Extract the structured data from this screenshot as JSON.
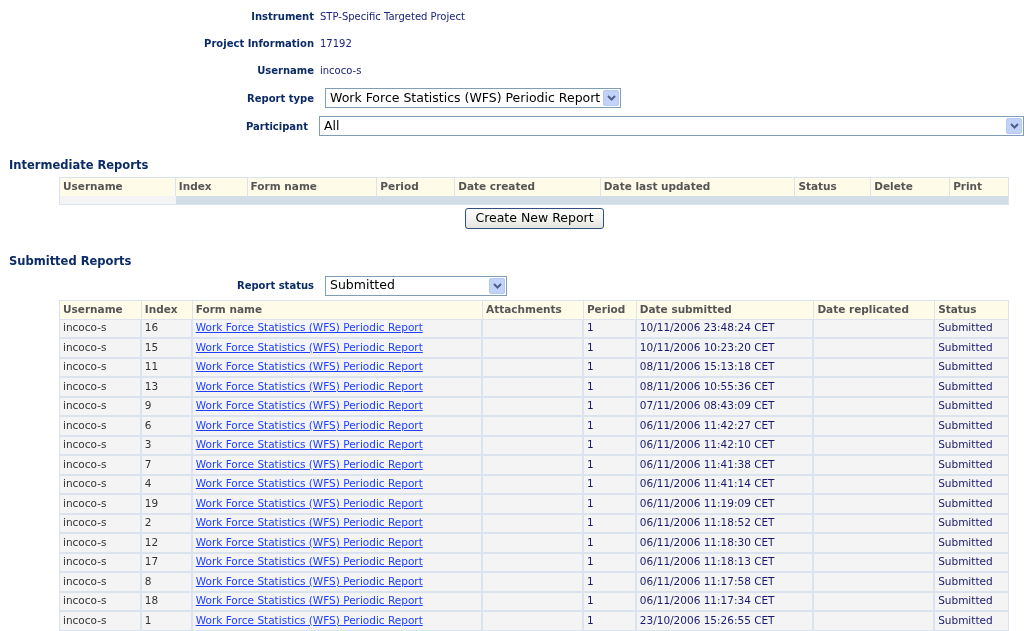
{
  "info": [
    {
      "label": "Instrument",
      "value": "STP-Specific Targeted Project"
    },
    {
      "label": "Project Information",
      "value": "17192"
    },
    {
      "label": "Username",
      "value": "incoco-s"
    }
  ],
  "filters": [
    {
      "label": "Report type",
      "value": "Work Force Statistics (WFS) Periodic Report",
      "kind": "short"
    },
    {
      "label": "Participant",
      "value": "All",
      "kind": "wide"
    }
  ],
  "intermediate": {
    "title": "Intermediate Reports",
    "columns": [
      "Username",
      "Index",
      "Form name",
      "Period",
      "Date created",
      "Date last updated",
      "Status",
      "Delete",
      "Print"
    ],
    "create_button": "Create New Report"
  },
  "submitted": {
    "title": "Submitted Reports",
    "status_filter": {
      "label": "Report status",
      "value": "Submitted"
    },
    "columns": [
      "Username",
      "Index",
      "Form name",
      "Attachments",
      "Period",
      "Date submitted",
      "Date replicated",
      "Status"
    ],
    "rows": [
      {
        "username": "incoco-s",
        "index": "16",
        "form_name": "Work Force Statistics (WFS) Periodic Report",
        "period": "1",
        "date_submitted": "10/11/2006 23:48:24 CET",
        "status": "Submitted"
      },
      {
        "username": "incoco-s",
        "index": "15",
        "form_name": "Work Force Statistics (WFS) Periodic Report",
        "period": "1",
        "date_submitted": "10/11/2006 10:23:20 CET",
        "status": "Submitted"
      },
      {
        "username": "incoco-s",
        "index": "11",
        "form_name": "Work Force Statistics (WFS) Periodic Report",
        "period": "1",
        "date_submitted": "08/11/2006 15:13:18 CET",
        "status": "Submitted"
      },
      {
        "username": "incoco-s",
        "index": "13",
        "form_name": "Work Force Statistics (WFS) Periodic Report",
        "period": "1",
        "date_submitted": "08/11/2006 10:55:36 CET",
        "status": "Submitted"
      },
      {
        "username": "incoco-s",
        "index": "9",
        "form_name": "Work Force Statistics (WFS) Periodic Report",
        "period": "1",
        "date_submitted": "07/11/2006 08:43:09 CET",
        "status": "Submitted"
      },
      {
        "username": "incoco-s",
        "index": "6",
        "form_name": "Work Force Statistics (WFS) Periodic Report",
        "period": "1",
        "date_submitted": "06/11/2006 11:42:27 CET",
        "status": "Submitted"
      },
      {
        "username": "incoco-s",
        "index": "3",
        "form_name": "Work Force Statistics (WFS) Periodic Report",
        "period": "1",
        "date_submitted": "06/11/2006 11:42:10 CET",
        "status": "Submitted"
      },
      {
        "username": "incoco-s",
        "index": "7",
        "form_name": "Work Force Statistics (WFS) Periodic Report",
        "period": "1",
        "date_submitted": "06/11/2006 11:41:38 CET",
        "status": "Submitted"
      },
      {
        "username": "incoco-s",
        "index": "4",
        "form_name": "Work Force Statistics (WFS) Periodic Report",
        "period": "1",
        "date_submitted": "06/11/2006 11:41:14 CET",
        "status": "Submitted"
      },
      {
        "username": "incoco-s",
        "index": "19",
        "form_name": "Work Force Statistics (WFS) Periodic Report",
        "period": "1",
        "date_submitted": "06/11/2006 11:19:09 CET",
        "status": "Submitted"
      },
      {
        "username": "incoco-s",
        "index": "2",
        "form_name": "Work Force Statistics (WFS) Periodic Report",
        "period": "1",
        "date_submitted": "06/11/2006 11:18:52 CET",
        "status": "Submitted"
      },
      {
        "username": "incoco-s",
        "index": "12",
        "form_name": "Work Force Statistics (WFS) Periodic Report",
        "period": "1",
        "date_submitted": "06/11/2006 11:18:30 CET",
        "status": "Submitted"
      },
      {
        "username": "incoco-s",
        "index": "17",
        "form_name": "Work Force Statistics (WFS) Periodic Report",
        "period": "1",
        "date_submitted": "06/11/2006 11:18:13 CET",
        "status": "Submitted"
      },
      {
        "username": "incoco-s",
        "index": "8",
        "form_name": "Work Force Statistics (WFS) Periodic Report",
        "period": "1",
        "date_submitted": "06/11/2006 11:17:58 CET",
        "status": "Submitted"
      },
      {
        "username": "incoco-s",
        "index": "18",
        "form_name": "Work Force Statistics (WFS) Periodic Report",
        "period": "1",
        "date_submitted": "06/11/2006 11:17:34 CET",
        "status": "Submitted"
      },
      {
        "username": "incoco-s",
        "index": "1",
        "form_name": "Work Force Statistics (WFS) Periodic Report",
        "period": "1",
        "date_submitted": "23/10/2006 15:26:55 CET",
        "status": "Submitted"
      }
    ]
  }
}
